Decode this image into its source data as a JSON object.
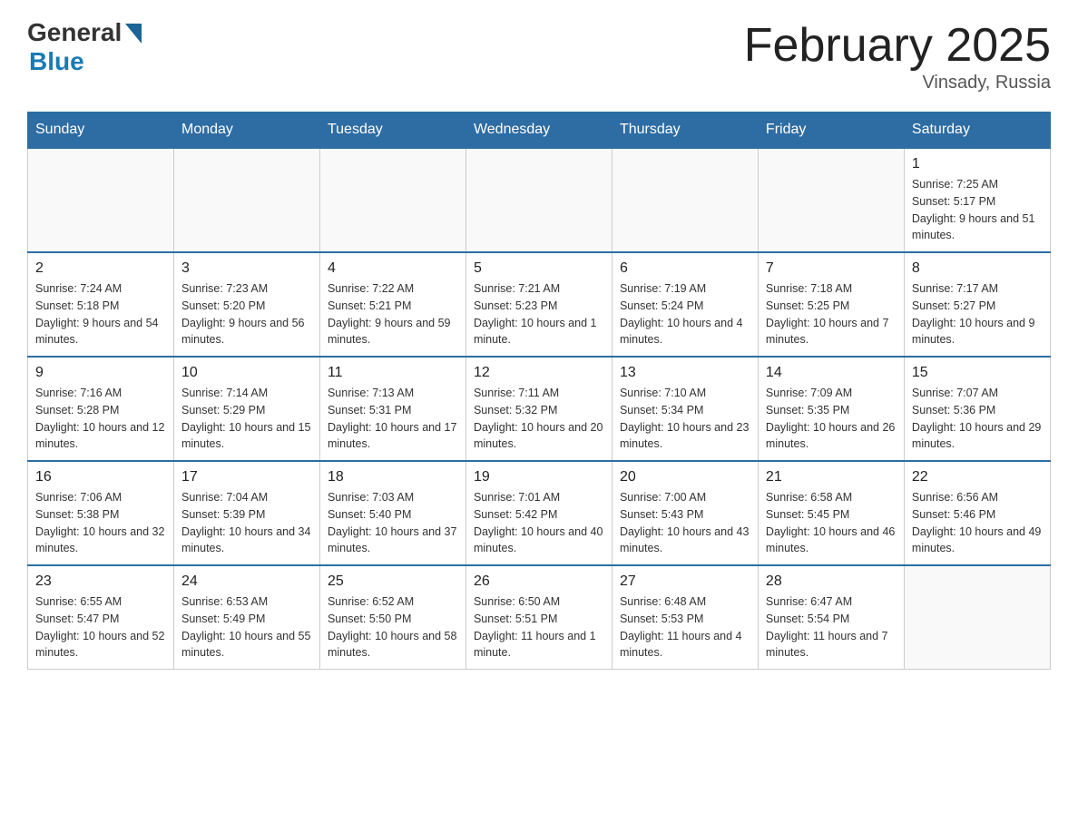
{
  "header": {
    "logo_general": "General",
    "logo_blue": "Blue",
    "month_title": "February 2025",
    "location": "Vinsady, Russia"
  },
  "weekdays": [
    "Sunday",
    "Monday",
    "Tuesday",
    "Wednesday",
    "Thursday",
    "Friday",
    "Saturday"
  ],
  "weeks": [
    [
      {
        "day": "",
        "info": ""
      },
      {
        "day": "",
        "info": ""
      },
      {
        "day": "",
        "info": ""
      },
      {
        "day": "",
        "info": ""
      },
      {
        "day": "",
        "info": ""
      },
      {
        "day": "",
        "info": ""
      },
      {
        "day": "1",
        "info": "Sunrise: 7:25 AM\nSunset: 5:17 PM\nDaylight: 9 hours and 51 minutes."
      }
    ],
    [
      {
        "day": "2",
        "info": "Sunrise: 7:24 AM\nSunset: 5:18 PM\nDaylight: 9 hours and 54 minutes."
      },
      {
        "day": "3",
        "info": "Sunrise: 7:23 AM\nSunset: 5:20 PM\nDaylight: 9 hours and 56 minutes."
      },
      {
        "day": "4",
        "info": "Sunrise: 7:22 AM\nSunset: 5:21 PM\nDaylight: 9 hours and 59 minutes."
      },
      {
        "day": "5",
        "info": "Sunrise: 7:21 AM\nSunset: 5:23 PM\nDaylight: 10 hours and 1 minute."
      },
      {
        "day": "6",
        "info": "Sunrise: 7:19 AM\nSunset: 5:24 PM\nDaylight: 10 hours and 4 minutes."
      },
      {
        "day": "7",
        "info": "Sunrise: 7:18 AM\nSunset: 5:25 PM\nDaylight: 10 hours and 7 minutes."
      },
      {
        "day": "8",
        "info": "Sunrise: 7:17 AM\nSunset: 5:27 PM\nDaylight: 10 hours and 9 minutes."
      }
    ],
    [
      {
        "day": "9",
        "info": "Sunrise: 7:16 AM\nSunset: 5:28 PM\nDaylight: 10 hours and 12 minutes."
      },
      {
        "day": "10",
        "info": "Sunrise: 7:14 AM\nSunset: 5:29 PM\nDaylight: 10 hours and 15 minutes."
      },
      {
        "day": "11",
        "info": "Sunrise: 7:13 AM\nSunset: 5:31 PM\nDaylight: 10 hours and 17 minutes."
      },
      {
        "day": "12",
        "info": "Sunrise: 7:11 AM\nSunset: 5:32 PM\nDaylight: 10 hours and 20 minutes."
      },
      {
        "day": "13",
        "info": "Sunrise: 7:10 AM\nSunset: 5:34 PM\nDaylight: 10 hours and 23 minutes."
      },
      {
        "day": "14",
        "info": "Sunrise: 7:09 AM\nSunset: 5:35 PM\nDaylight: 10 hours and 26 minutes."
      },
      {
        "day": "15",
        "info": "Sunrise: 7:07 AM\nSunset: 5:36 PM\nDaylight: 10 hours and 29 minutes."
      }
    ],
    [
      {
        "day": "16",
        "info": "Sunrise: 7:06 AM\nSunset: 5:38 PM\nDaylight: 10 hours and 32 minutes."
      },
      {
        "day": "17",
        "info": "Sunrise: 7:04 AM\nSunset: 5:39 PM\nDaylight: 10 hours and 34 minutes."
      },
      {
        "day": "18",
        "info": "Sunrise: 7:03 AM\nSunset: 5:40 PM\nDaylight: 10 hours and 37 minutes."
      },
      {
        "day": "19",
        "info": "Sunrise: 7:01 AM\nSunset: 5:42 PM\nDaylight: 10 hours and 40 minutes."
      },
      {
        "day": "20",
        "info": "Sunrise: 7:00 AM\nSunset: 5:43 PM\nDaylight: 10 hours and 43 minutes."
      },
      {
        "day": "21",
        "info": "Sunrise: 6:58 AM\nSunset: 5:45 PM\nDaylight: 10 hours and 46 minutes."
      },
      {
        "day": "22",
        "info": "Sunrise: 6:56 AM\nSunset: 5:46 PM\nDaylight: 10 hours and 49 minutes."
      }
    ],
    [
      {
        "day": "23",
        "info": "Sunrise: 6:55 AM\nSunset: 5:47 PM\nDaylight: 10 hours and 52 minutes."
      },
      {
        "day": "24",
        "info": "Sunrise: 6:53 AM\nSunset: 5:49 PM\nDaylight: 10 hours and 55 minutes."
      },
      {
        "day": "25",
        "info": "Sunrise: 6:52 AM\nSunset: 5:50 PM\nDaylight: 10 hours and 58 minutes."
      },
      {
        "day": "26",
        "info": "Sunrise: 6:50 AM\nSunset: 5:51 PM\nDaylight: 11 hours and 1 minute."
      },
      {
        "day": "27",
        "info": "Sunrise: 6:48 AM\nSunset: 5:53 PM\nDaylight: 11 hours and 4 minutes."
      },
      {
        "day": "28",
        "info": "Sunrise: 6:47 AM\nSunset: 5:54 PM\nDaylight: 11 hours and 7 minutes."
      },
      {
        "day": "",
        "info": ""
      }
    ]
  ]
}
